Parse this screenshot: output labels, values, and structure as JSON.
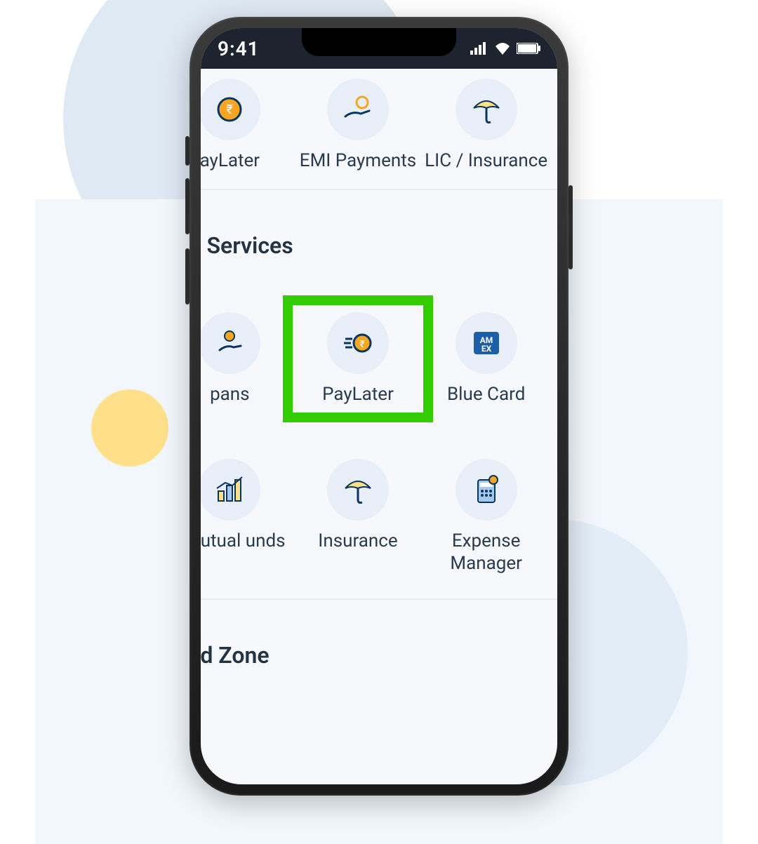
{
  "status_bar": {
    "time": "9:41"
  },
  "top_row": [
    {
      "label": "ayLater",
      "icon": "coin-orange"
    },
    {
      "label": "EMI Payments",
      "icon": "hand-coin"
    },
    {
      "label": "LIC / Insurance",
      "icon": "umbrella"
    }
  ],
  "section1_title": "cial Services",
  "section1_row1": [
    {
      "label": "pans",
      "icon": "hand-coin-small",
      "highlighted": false
    },
    {
      "label": "PayLater",
      "icon": "coin-speed",
      "highlighted": true
    },
    {
      "label": "Blue Card",
      "icon": "amex-box",
      "highlighted": false
    }
  ],
  "section1_row2": [
    {
      "label": "t Mutual unds",
      "icon": "chart-bars"
    },
    {
      "label": "Insurance",
      "icon": "umbrella"
    },
    {
      "label": "Expense Manager",
      "icon": "calculator"
    }
  ],
  "section2_title": "Card Zone"
}
